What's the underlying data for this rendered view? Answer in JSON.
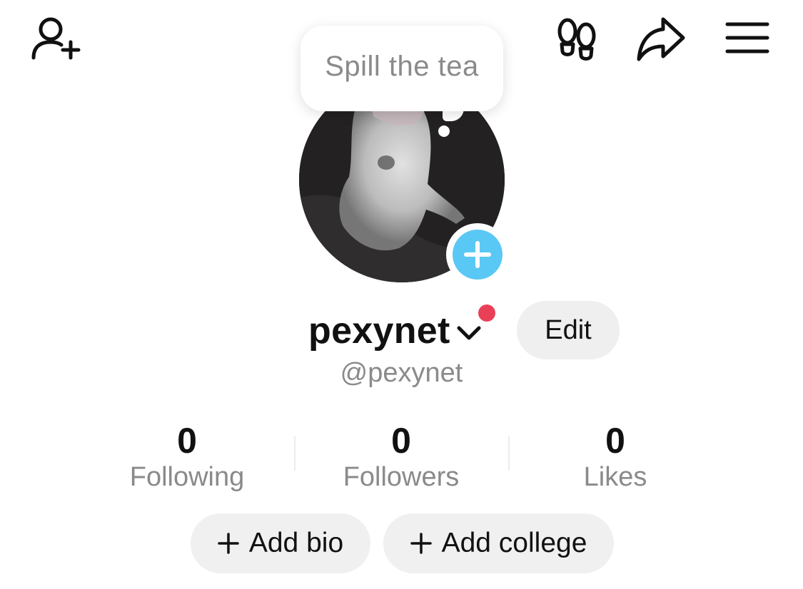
{
  "header": {
    "add_friend_icon": "person-plus-icon",
    "footprints_icon": "footprints-icon",
    "share_icon": "share-arrow-icon",
    "menu_icon": "hamburger-menu-icon"
  },
  "status_bubble": {
    "text": "Spill the tea"
  },
  "profile": {
    "display_name": "pexynet",
    "handle": "@pexynet",
    "edit_label": "Edit",
    "notification_color": "#ea4057",
    "add_avatar_color": "#5ac8f5"
  },
  "stats": [
    {
      "value": "0",
      "label": "Following"
    },
    {
      "value": "0",
      "label": "Followers"
    },
    {
      "value": "0",
      "label": "Likes"
    }
  ],
  "actions": {
    "add_bio_label": "Add bio",
    "add_college_label": "Add college"
  }
}
